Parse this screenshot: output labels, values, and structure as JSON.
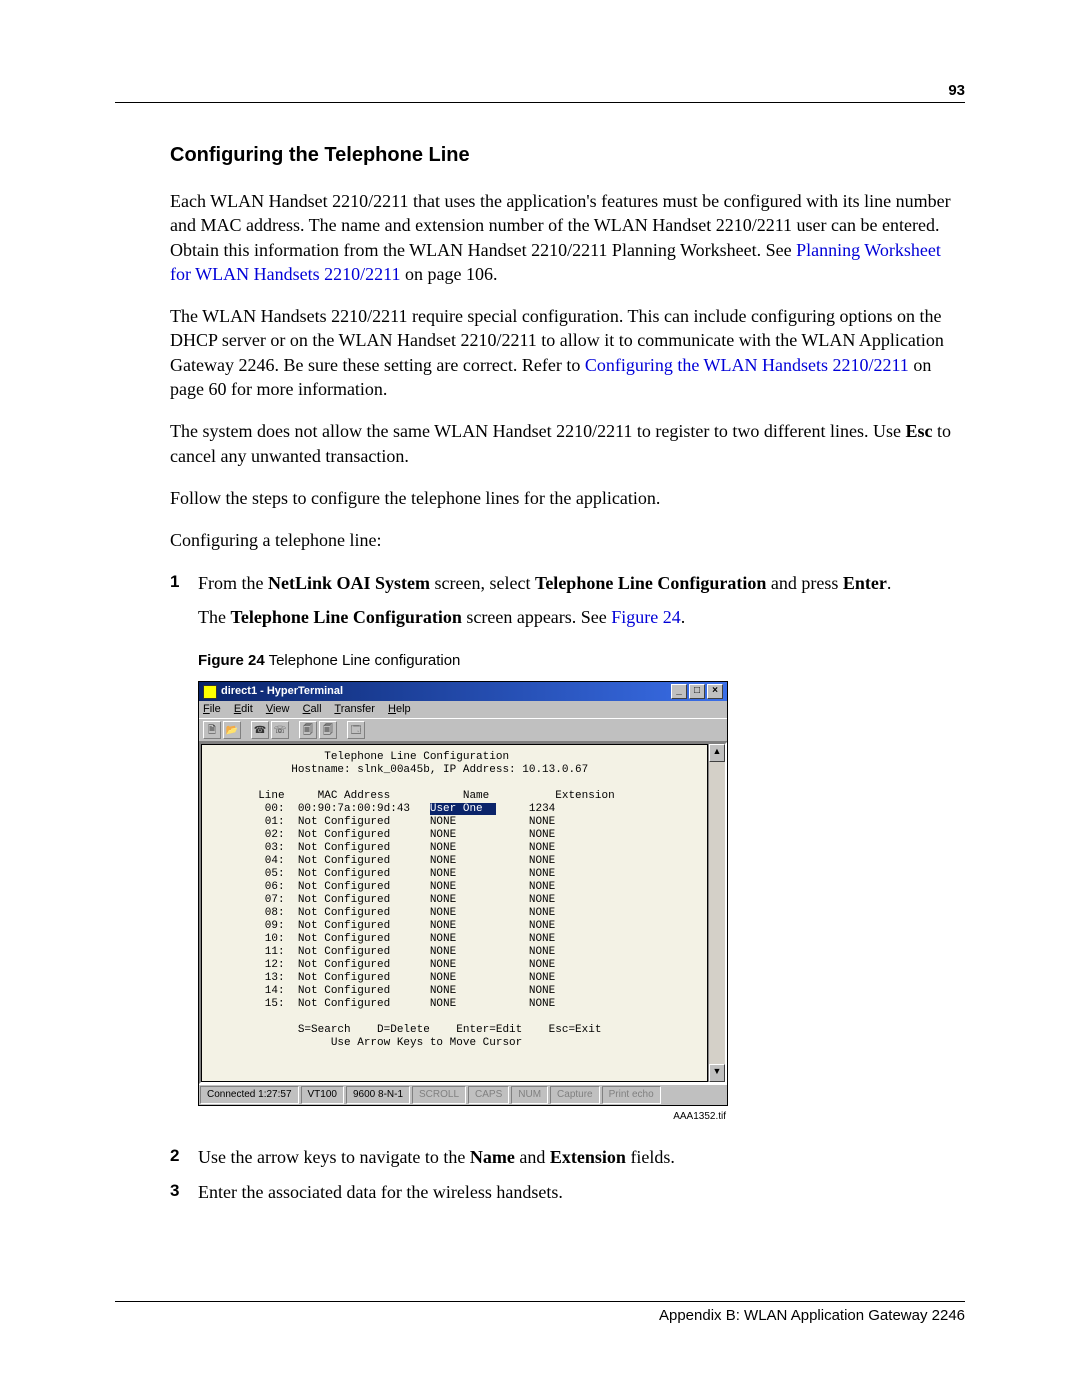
{
  "page_number": "93",
  "heading": "Configuring the Telephone Line",
  "para1_a": "Each WLAN Handset 2210/2211 that uses the application's features must be configured with its line number and MAC address. The name and extension number of the WLAN Handset 2210/2211 user can be entered. Obtain this information from the WLAN Handset 2210/2211 Planning Worksheet. See ",
  "para1_link": "Planning Worksheet for WLAN Handsets 2210/2211",
  "para1_b": " on page 106.",
  "para2_a": "The WLAN Handsets 2210/2211 require special configuration. This can include configuring options on the DHCP server or on the WLAN Handset 2210/2211 to allow it to communicate with the WLAN Application Gateway 2246. Be sure these setting are correct. Refer to ",
  "para2_link": "Configuring the WLAN Handsets 2210/2211",
  "para2_b": " on page 60 for more information.",
  "para3_a": "The system does not allow the same WLAN Handset 2210/2211 to register to two different lines. Use ",
  "para3_bold": "Esc",
  "para3_b": " to cancel any unwanted transaction.",
  "para4": "Follow the steps to configure the telephone lines for the application.",
  "para5": "Configuring a telephone line:",
  "step1_num": "1",
  "step1_a": "From the ",
  "step1_b1": "NetLink OAI System",
  "step1_c": " screen, select ",
  "step1_b2": "Telephone Line Configuration",
  "step1_d": " and press ",
  "step1_b3": "Enter",
  "step1_e": ".",
  "step1p2_a": "The ",
  "step1p2_b": "Telephone Line Configuration",
  "step1p2_c": " screen appears. See ",
  "step1p2_link": "Figure 24",
  "step1p2_d": ".",
  "fig_label": "Figure 24",
  "fig_caption": "   Telephone Line configuration",
  "ht": {
    "title": "direct1 - HyperTerminal",
    "menu": [
      "File",
      "Edit",
      "View",
      "Call",
      "Transfer",
      "Help"
    ],
    "term_title": "Telephone Line Configuration",
    "term_host": "Hostname: slnk_00a45b, IP Address: 10.13.0.67",
    "header": {
      "c1": "Line",
      "c2": "MAC Address",
      "c3": "Name",
      "c4": "Extension"
    },
    "rows": [
      {
        "line": "00:",
        "mac": "00:90:7a:00:9d:43",
        "name": "User One",
        "ext": "1234",
        "sel": true
      },
      {
        "line": "01:",
        "mac": "Not Configured",
        "name": "NONE",
        "ext": "NONE"
      },
      {
        "line": "02:",
        "mac": "Not Configured",
        "name": "NONE",
        "ext": "NONE"
      },
      {
        "line": "03:",
        "mac": "Not Configured",
        "name": "NONE",
        "ext": "NONE"
      },
      {
        "line": "04:",
        "mac": "Not Configured",
        "name": "NONE",
        "ext": "NONE"
      },
      {
        "line": "05:",
        "mac": "Not Configured",
        "name": "NONE",
        "ext": "NONE"
      },
      {
        "line": "06:",
        "mac": "Not Configured",
        "name": "NONE",
        "ext": "NONE"
      },
      {
        "line": "07:",
        "mac": "Not Configured",
        "name": "NONE",
        "ext": "NONE"
      },
      {
        "line": "08:",
        "mac": "Not Configured",
        "name": "NONE",
        "ext": "NONE"
      },
      {
        "line": "09:",
        "mac": "Not Configured",
        "name": "NONE",
        "ext": "NONE"
      },
      {
        "line": "10:",
        "mac": "Not Configured",
        "name": "NONE",
        "ext": "NONE"
      },
      {
        "line": "11:",
        "mac": "Not Configured",
        "name": "NONE",
        "ext": "NONE"
      },
      {
        "line": "12:",
        "mac": "Not Configured",
        "name": "NONE",
        "ext": "NONE"
      },
      {
        "line": "13:",
        "mac": "Not Configured",
        "name": "NONE",
        "ext": "NONE"
      },
      {
        "line": "14:",
        "mac": "Not Configured",
        "name": "NONE",
        "ext": "NONE"
      },
      {
        "line": "15:",
        "mac": "Not Configured",
        "name": "NONE",
        "ext": "NONE"
      }
    ],
    "cmds": "S=Search    D=Delete    Enter=Edit    Esc=Exit",
    "cmds2": "Use Arrow Keys to Move Cursor",
    "status": [
      "Connected 1:27:57",
      "VT100",
      "9600 8-N-1",
      "SCROLL",
      "CAPS",
      "NUM",
      "Capture",
      "Print echo"
    ]
  },
  "fig_id": "AAA1352.tif",
  "step2_num": "2",
  "step2_a": "Use the arrow keys to navigate to the ",
  "step2_b1": "Name",
  "step2_m": " and ",
  "step2_b2": "Extension",
  "step2_c": " fields.",
  "step3_num": "3",
  "step3_a": "Enter the associated data for the wireless handsets.",
  "footer": "Appendix B: WLAN Application Gateway 2246"
}
